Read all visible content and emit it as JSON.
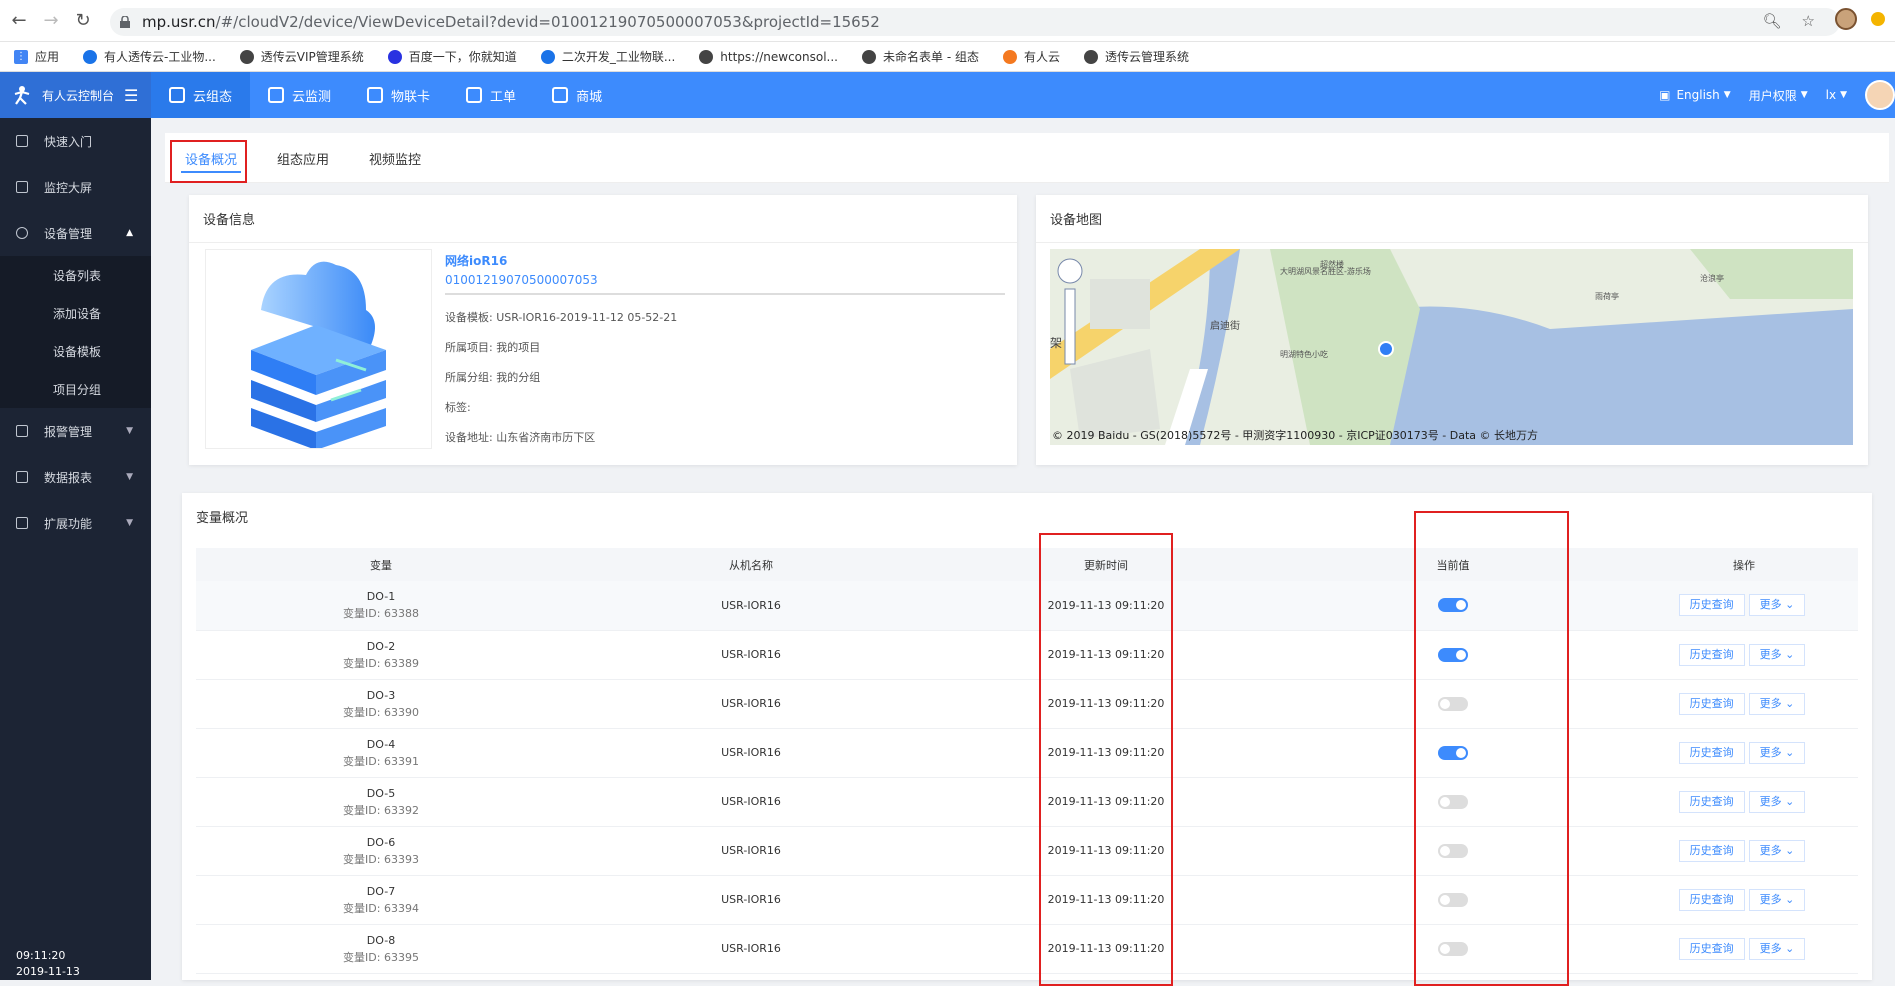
{
  "browser": {
    "url_host": "mp.usr.cn",
    "url_rest": "/#/cloudV2/device/ViewDeviceDetail?devid=01001219070500007053&projectId=15652",
    "bookmarks": [
      {
        "label": "应用",
        "color": "#4285f4"
      },
      {
        "label": "有人透传云-工业物...",
        "color": "#1a73e8"
      },
      {
        "label": "透传云VIP管理系统",
        "color": "#444"
      },
      {
        "label": "百度一下，你就知道",
        "color": "#2932e1"
      },
      {
        "label": "二次开发_工业物联...",
        "color": "#1a73e8"
      },
      {
        "label": "https://newconsol...",
        "color": "#444"
      },
      {
        "label": "未命名表单 - 组态",
        "color": "#444"
      },
      {
        "label": "有人云",
        "color": "#f47920"
      },
      {
        "label": "透传云管理系统",
        "color": "#444"
      }
    ]
  },
  "header": {
    "brand": "有人云控制台",
    "nav": [
      {
        "label": "云组态",
        "active": true
      },
      {
        "label": "云监测",
        "active": false
      },
      {
        "label": "物联卡",
        "active": false
      },
      {
        "label": "工单",
        "active": false
      },
      {
        "label": "商城",
        "active": false
      }
    ],
    "language": "English",
    "permission": "用户权限",
    "user": "lx"
  },
  "sidebar": {
    "items": [
      {
        "label": "快速入门"
      },
      {
        "label": "监控大屏"
      },
      {
        "label": "设备管理"
      }
    ],
    "sub_items": [
      {
        "label": "设备列表"
      },
      {
        "label": "添加设备"
      },
      {
        "label": "设备模板"
      },
      {
        "label": "项目分组"
      }
    ],
    "items2": [
      {
        "label": "报警管理"
      },
      {
        "label": "数据报表"
      },
      {
        "label": "扩展功能"
      }
    ],
    "time": "09:11:20",
    "date": "2019-11-13"
  },
  "tabs": [
    {
      "label": "设备概况"
    },
    {
      "label": "组态应用"
    },
    {
      "label": "视频监控"
    }
  ],
  "device_info": {
    "title": "设备信息",
    "name": "网络ioR16",
    "id": "01001219070500007053",
    "rows": [
      "设备模板: USR-IOR16-2019-11-12 05-52-21",
      "所属项目: 我的项目",
      "所属分组: 我的分组",
      "标签:",
      "设备地址: 山东省济南市历下区"
    ]
  },
  "device_map": {
    "title": "设备地图",
    "copyright": "© 2019 Baidu - GS(2018)5572号 - 甲测资字1100930 - 京ICP证030173号 - Data © 长地万方",
    "labels": [
      "大明湖风景名胜区-游乐场",
      "超然楼",
      "明湖特色小吃",
      "沧浪亭",
      "雨荷亭",
      "启迪街",
      "架"
    ]
  },
  "variables": {
    "title": "变量概况",
    "headers": [
      "变量",
      "从机名称",
      "更新时间",
      "当前值",
      "操作"
    ],
    "history_label": "历史查询",
    "more_label": "更多",
    "rows": [
      {
        "name": "DO-1",
        "vid": "变量ID: 63388",
        "slave": "USR-IOR16",
        "time": "2019-11-13 09:11:20",
        "on": true
      },
      {
        "name": "DO-2",
        "vid": "变量ID: 63389",
        "slave": "USR-IOR16",
        "time": "2019-11-13 09:11:20",
        "on": true
      },
      {
        "name": "DO-3",
        "vid": "变量ID: 63390",
        "slave": "USR-IOR16",
        "time": "2019-11-13 09:11:20",
        "on": false
      },
      {
        "name": "DO-4",
        "vid": "变量ID: 63391",
        "slave": "USR-IOR16",
        "time": "2019-11-13 09:11:20",
        "on": true
      },
      {
        "name": "DO-5",
        "vid": "变量ID: 63392",
        "slave": "USR-IOR16",
        "time": "2019-11-13 09:11:20",
        "on": false
      },
      {
        "name": "DO-6",
        "vid": "变量ID: 63393",
        "slave": "USR-IOR16",
        "time": "2019-11-13 09:11:20",
        "on": false
      },
      {
        "name": "DO-7",
        "vid": "变量ID: 63394",
        "slave": "USR-IOR16",
        "time": "2019-11-13 09:11:20",
        "on": false
      },
      {
        "name": "DO-8",
        "vid": "变量ID: 63395",
        "slave": "USR-IOR16",
        "time": "2019-11-13 09:11:20",
        "on": false
      }
    ]
  },
  "colors": {
    "accent": "#3d8bfd",
    "sidebar": "#1c2434",
    "highlight": "#e02020"
  }
}
